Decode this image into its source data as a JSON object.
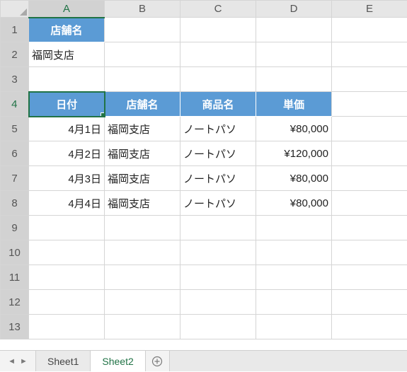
{
  "columns": [
    "A",
    "B",
    "C",
    "D",
    "E"
  ],
  "rows": [
    "1",
    "2",
    "3",
    "4",
    "5",
    "6",
    "7",
    "8",
    "9",
    "10",
    "11",
    "12",
    "13"
  ],
  "activeCell": "A4",
  "header1": {
    "A": "店舗名"
  },
  "row2": {
    "A": "福岡支店"
  },
  "header4": {
    "A": "日付",
    "B": "店舗名",
    "C": "商品名",
    "D": "単価"
  },
  "data": [
    {
      "date": "4月1日",
      "store": "福岡支店",
      "product": "ノートパソ",
      "price": "¥80,000"
    },
    {
      "date": "4月2日",
      "store": "福岡支店",
      "product": "ノートパソ",
      "price": "¥120,000"
    },
    {
      "date": "4月3日",
      "store": "福岡支店",
      "product": "ノートパソ",
      "price": "¥80,000"
    },
    {
      "date": "4月4日",
      "store": "福岡支店",
      "product": "ノートパソ",
      "price": "¥80,000"
    }
  ],
  "tabs": {
    "sheet1": "Sheet1",
    "sheet2": "Sheet2",
    "active": "Sheet2"
  }
}
